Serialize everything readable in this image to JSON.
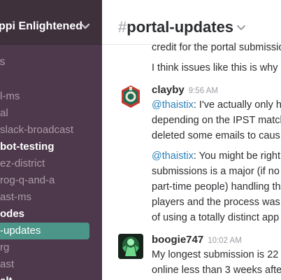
{
  "sidebar": {
    "team_name": "ppi Enlightened",
    "section_label": "ls",
    "channels": [
      {
        "label": "l-ms",
        "state": "normal"
      },
      {
        "label": "al",
        "state": "normal"
      },
      {
        "label": "slack-broadcast",
        "state": "normal"
      },
      {
        "label": "bot-testing",
        "state": "bold"
      },
      {
        "label": "ez-district",
        "state": "normal"
      },
      {
        "label": "rog-q-and-a",
        "state": "normal"
      },
      {
        "label": "ast-ms",
        "state": "normal"
      },
      {
        "label": "odes",
        "state": "bold"
      },
      {
        "label": "-updates",
        "state": "active"
      },
      {
        "label": "rg",
        "state": "normal"
      },
      {
        "label": "ast",
        "state": "normal"
      },
      {
        "label": "alt",
        "state": "bold"
      }
    ]
  },
  "channel": {
    "hash": "#",
    "name": "portal-updates"
  },
  "messages": {
    "prev_line1": "credit for the portal submissions",
    "prev_line2": "I think issues like this is why",
    "clayby": {
      "author": "clayby",
      "time": "9:56 AM",
      "p1_mention": "@thaistix",
      "p1_line1_rest": ": I've actually only h",
      "p1_line2": "depending on the IPST match",
      "p1_line3": "deleted some emails to caus",
      "p2_mention": "@thaistix",
      "p2_line1_rest": ": You might be right",
      "p2_line2": "submissions is a major (if no",
      "p2_line3": "part-time people) handling th",
      "p2_line4": "players and the process was",
      "p2_line5": "of using a totally distinct app"
    },
    "boogie": {
      "author": "boogie747",
      "time": "10:02 AM",
      "line1": "My longest submission is 22",
      "line2": "online less than 3 weeks afte"
    }
  },
  "colors": {
    "sidebar_bg": "#4d394b",
    "sidebar_header_bg": "#3e313c",
    "active_channel": "#4c9689",
    "mention": "#2a80b9"
  }
}
